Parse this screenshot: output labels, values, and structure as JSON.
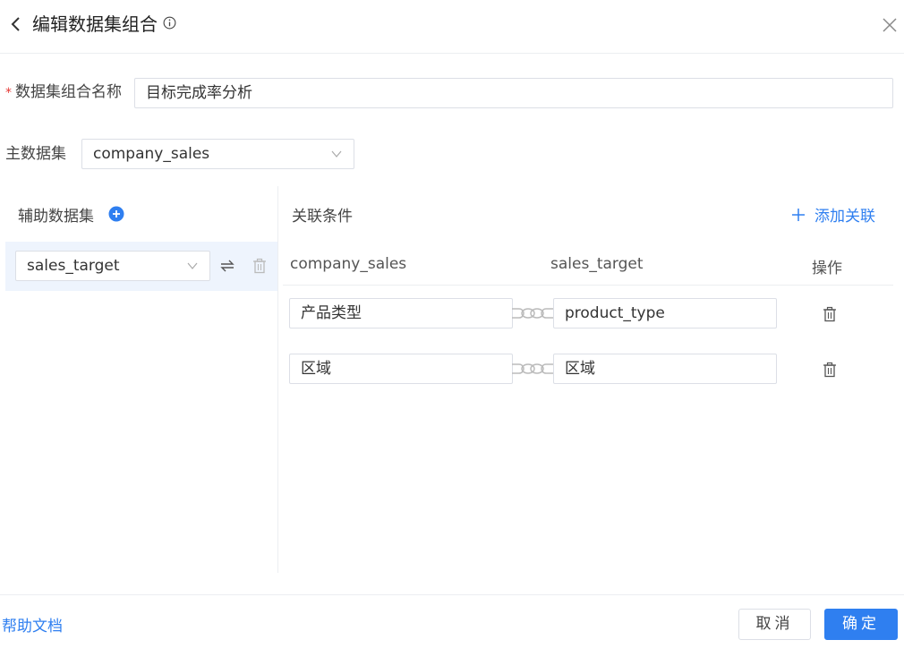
{
  "header": {
    "title": "编辑数据集组合"
  },
  "form": {
    "name_label": "数据集组合名称",
    "name_value": "目标完成率分析",
    "main_label": "主数据集",
    "main_value": "company_sales"
  },
  "aux": {
    "title": "辅助数据集",
    "items": [
      {
        "value": "sales_target"
      }
    ]
  },
  "relations": {
    "title": "关联条件",
    "add_label": "添加关联",
    "columns": [
      "company_sales",
      "sales_target",
      "操作"
    ],
    "rows": [
      {
        "left": "产品类型",
        "right": "product_type"
      },
      {
        "left": "区域",
        "right": "区域"
      }
    ]
  },
  "footer": {
    "help": "帮助文档",
    "cancel": "取消",
    "ok": "确定"
  },
  "colors": {
    "primary": "#2f7ff0",
    "required": "#e53935",
    "selected_row_bg": "#eef4fd"
  }
}
